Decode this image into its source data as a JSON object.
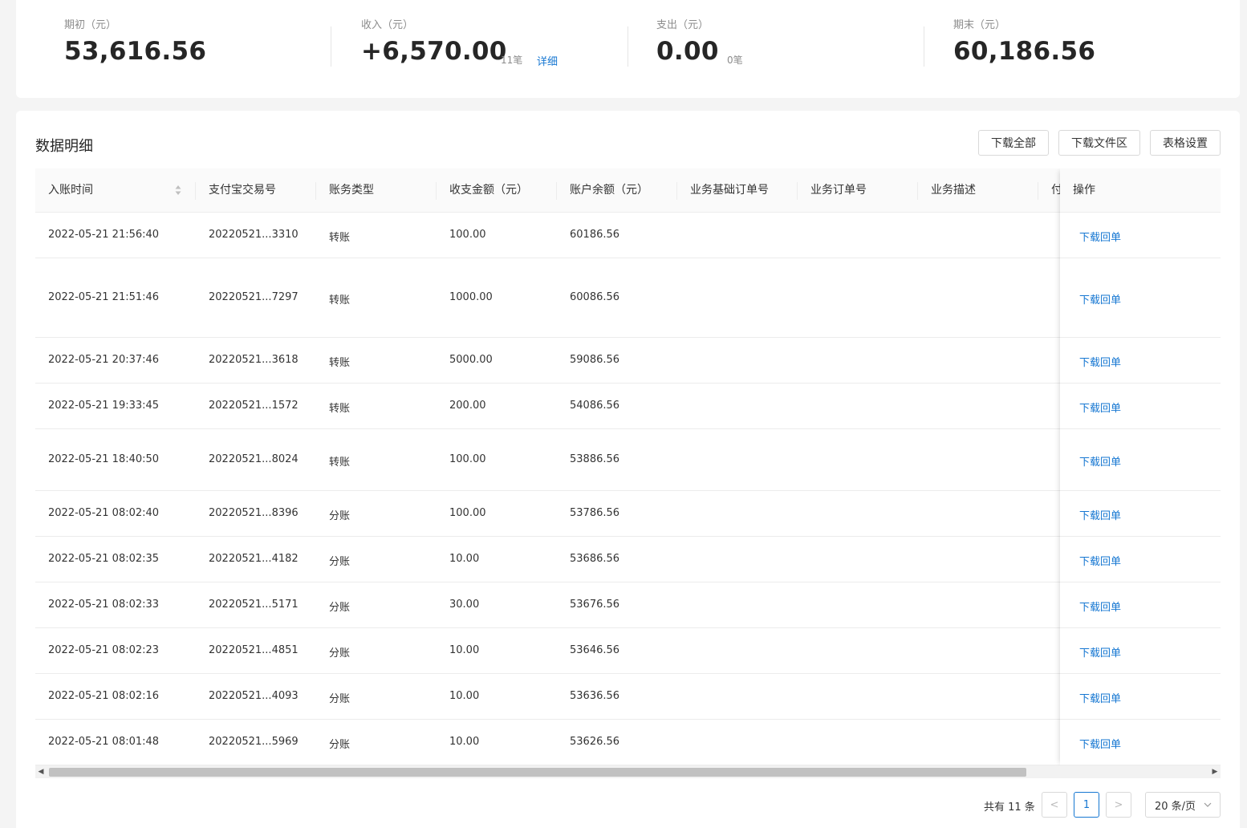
{
  "summary": [
    {
      "label": "期初（元）",
      "value": "53,616.56"
    },
    {
      "label": "收入（元）",
      "value": "+6,570.00",
      "count": "11笔",
      "detail": "详细"
    },
    {
      "label": "支出（元）",
      "value": "0.00",
      "count": "0笔"
    },
    {
      "label": "期末（元）",
      "value": "60,186.56"
    }
  ],
  "panel": {
    "title": "数据明细",
    "buttons": [
      "下载全部",
      "下载文件区",
      "表格设置"
    ]
  },
  "table": {
    "columns": [
      "入账时间",
      "支付宝交易号",
      "账务类型",
      "收支金额（元）",
      "账户余额（元）",
      "业务基础订单号",
      "业务订单号",
      "业务描述",
      "付"
    ],
    "action_header": "操作",
    "action_label": "下载回单",
    "rows": [
      {
        "time": "2022-05-21 21:56:40",
        "trade_no": "20220521...3310",
        "type": "转账",
        "amount": "100.00",
        "balance": "60186.56"
      },
      {
        "time": "2022-05-21 21:51:46",
        "trade_no": "20220521...7297",
        "type": "转账",
        "amount": "1000.00",
        "balance": "60086.56"
      },
      {
        "time": "2022-05-21 20:37:46",
        "trade_no": "20220521...3618",
        "type": "转账",
        "amount": "5000.00",
        "balance": "59086.56"
      },
      {
        "time": "2022-05-21 19:33:45",
        "trade_no": "20220521...1572",
        "type": "转账",
        "amount": "200.00",
        "balance": "54086.56"
      },
      {
        "time": "2022-05-21 18:40:50",
        "trade_no": "20220521...8024",
        "type": "转账",
        "amount": "100.00",
        "balance": "53886.56"
      },
      {
        "time": "2022-05-21 08:02:40",
        "trade_no": "20220521...8396",
        "type": "分账",
        "amount": "100.00",
        "balance": "53786.56"
      },
      {
        "time": "2022-05-21 08:02:35",
        "trade_no": "20220521...4182",
        "type": "分账",
        "amount": "10.00",
        "balance": "53686.56"
      },
      {
        "time": "2022-05-21 08:02:33",
        "trade_no": "20220521...5171",
        "type": "分账",
        "amount": "30.00",
        "balance": "53676.56"
      },
      {
        "time": "2022-05-21 08:02:23",
        "trade_no": "20220521...4851",
        "type": "分账",
        "amount": "10.00",
        "balance": "53646.56"
      },
      {
        "time": "2022-05-21 08:02:16",
        "trade_no": "20220521...4093",
        "type": "分账",
        "amount": "10.00",
        "balance": "53636.56"
      },
      {
        "time": "2022-05-21 08:01:48",
        "trade_no": "20220521...5969",
        "type": "分账",
        "amount": "10.00",
        "balance": "53626.56"
      }
    ]
  },
  "pagination": {
    "total": "共有 11 条",
    "prev": "<",
    "current": "1",
    "next": ">",
    "page_size": "20 条/页"
  }
}
